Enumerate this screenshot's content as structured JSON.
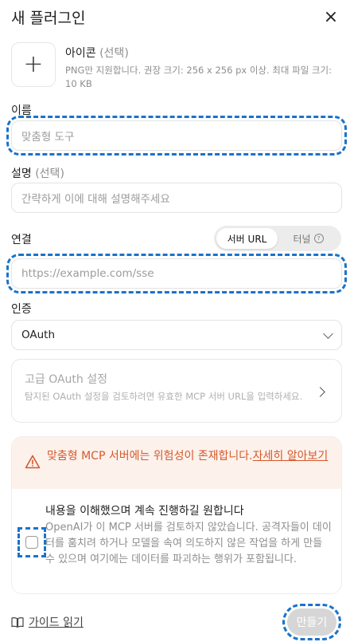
{
  "dialog": {
    "title": "새 플러그인",
    "close_symbol": "×"
  },
  "icon": {
    "label": "아이콘",
    "optional": "(선택)",
    "help": "PNG만 지원합니다. 권장 크기: 256 x 256 px 이상. 최대 파일 크기: 10 KB"
  },
  "name": {
    "label": "이름",
    "placeholder": "맞춤형 도구"
  },
  "description": {
    "label": "설명",
    "optional": "(선택)",
    "placeholder": "간략하게 이에 대해 설명해주세요"
  },
  "connection": {
    "label": "연결",
    "options": [
      "서버 URL",
      "터널"
    ],
    "selected": "서버 URL",
    "placeholder": "https://example.com/sse"
  },
  "auth": {
    "label": "인증",
    "value": "OAuth"
  },
  "advanced": {
    "title": "고급 OAuth 설정",
    "description": "탐지된 OAuth 설정을 검토하려면 유효한 MCP 서버 URL을 입력하세요."
  },
  "warning": {
    "text": "맞춤형 MCP 서버에는 위험성이 존재합니다.",
    "link": "자세히 알아보기",
    "color": "#d55a2b",
    "consent_title": "내용을 이해했으며 계속 진행하길 원합니다",
    "consent_desc": "OpenAI가 이 MCP 서버를 검토하지 않았습니다. 공격자들이 데이터를 훔치려 하거나 모델을 속여 의도하지 않은 작업을 하게 만들 수 있으며 여기에는 데이터를 파괴하는 행위가 포함됩니다."
  },
  "footer": {
    "guide": "가이드 읽기",
    "create": "만들기"
  }
}
